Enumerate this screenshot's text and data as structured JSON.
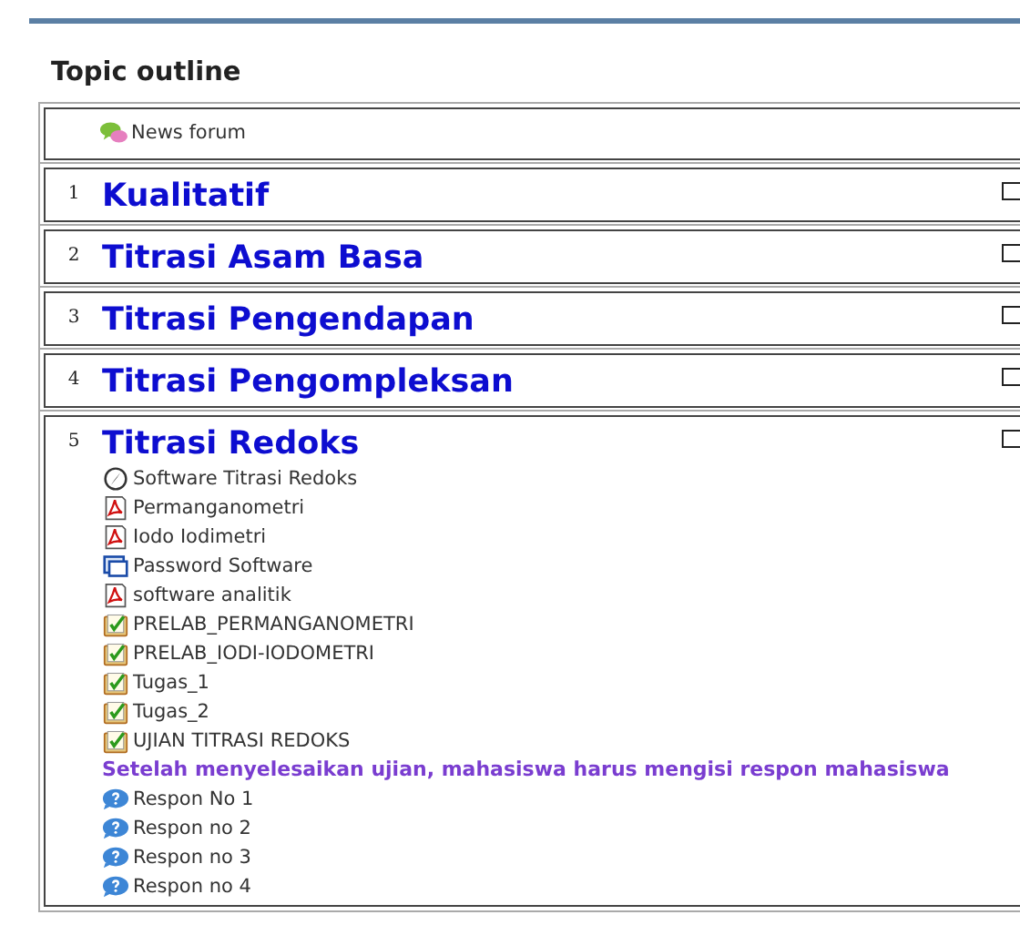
{
  "heading": "Topic outline",
  "news": {
    "label": "News forum",
    "kind": "forum"
  },
  "sections": [
    {
      "number": "1",
      "title": "Kualitatif"
    },
    {
      "number": "2",
      "title": "Titrasi Asam Basa"
    },
    {
      "number": "3",
      "title": "Titrasi Pengendapan"
    },
    {
      "number": "4",
      "title": "Titrasi Pengompleksan"
    },
    {
      "number": "5",
      "title": "Titrasi Redoks",
      "items": [
        {
          "kind": "software",
          "label": "Software Titrasi Redoks"
        },
        {
          "kind": "pdf",
          "label": "Permanganometri"
        },
        {
          "kind": "pdf",
          "label": "Iodo Iodimetri"
        },
        {
          "kind": "url",
          "label": "Password Software"
        },
        {
          "kind": "pdf",
          "label": "software analitik"
        },
        {
          "kind": "quiz",
          "label": "PRELAB_PERMANGANOMETRI"
        },
        {
          "kind": "quiz",
          "label": "PRELAB_IODI-IODOMETRI"
        },
        {
          "kind": "quiz",
          "label": "Tugas_1"
        },
        {
          "kind": "quiz",
          "label": "Tugas_2"
        },
        {
          "kind": "quiz",
          "label": "UJIAN TITRASI REDOKS"
        },
        {
          "kind": "label",
          "label": "Setelah menyelesaikan ujian, mahasiswa harus mengisi respon mahasiswa"
        },
        {
          "kind": "feedback",
          "label": "Respon No 1"
        },
        {
          "kind": "feedback",
          "label": "Respon no 2"
        },
        {
          "kind": "feedback",
          "label": "Respon no 3"
        },
        {
          "kind": "feedback",
          "label": "Respon no 4"
        }
      ]
    }
  ]
}
